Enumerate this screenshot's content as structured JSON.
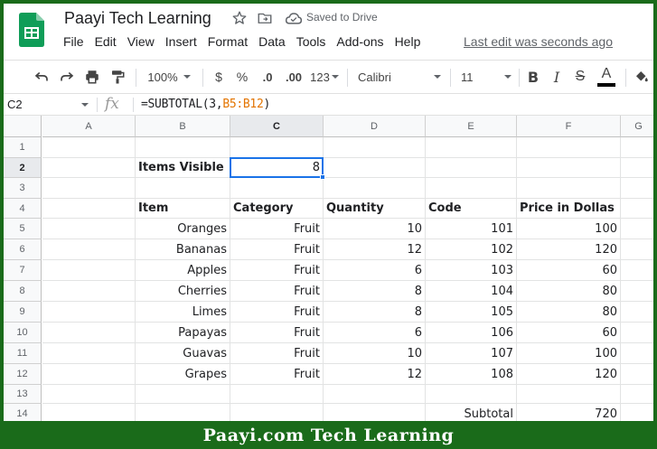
{
  "window": {
    "doc_title": "Paayi Tech Learning",
    "saved_status": "Saved to Drive",
    "last_edit": "Last edit was seconds ago"
  },
  "menu": [
    "File",
    "Edit",
    "View",
    "Insert",
    "Format",
    "Data",
    "Tools",
    "Add-ons",
    "Help"
  ],
  "toolbar": {
    "zoom": "100%",
    "currency": "$",
    "percent": "%",
    "decrease_decimal": ".0",
    "increase_decimal": ".00",
    "more_formats": "123",
    "font": "Calibri",
    "font_size": "11",
    "bold": "B",
    "italic": "I",
    "strike": "S",
    "text_color": "A"
  },
  "formula_bar": {
    "cell_ref": "C2",
    "fx": "fx",
    "formula_prefix": "=SUBTOTAL(3,",
    "formula_ref": "B5:B12",
    "formula_suffix": ")"
  },
  "columns": [
    "A",
    "B",
    "C",
    "D",
    "E",
    "F",
    "G"
  ],
  "rows": [
    "1",
    "2",
    "3",
    "4",
    "5",
    "6",
    "7",
    "8",
    "9",
    "10",
    "11",
    "12",
    "13",
    "14"
  ],
  "sheet": {
    "items_visible_label": "Items Visible",
    "items_visible_value": "8",
    "headers": [
      "Item",
      "Category",
      "Quantity",
      "Code",
      "Price in Dollas"
    ],
    "data": [
      [
        "Oranges",
        "Fruit",
        "10",
        "101",
        "100"
      ],
      [
        "Bananas",
        "Fruit",
        "12",
        "102",
        "120"
      ],
      [
        "Apples",
        "Fruit",
        "6",
        "103",
        "60"
      ],
      [
        "Cherries",
        "Fruit",
        "8",
        "104",
        "80"
      ],
      [
        "Limes",
        "Fruit",
        "8",
        "105",
        "80"
      ],
      [
        "Papayas",
        "Fruit",
        "6",
        "106",
        "60"
      ],
      [
        "Guavas",
        "Fruit",
        "10",
        "107",
        "100"
      ],
      [
        "Grapes",
        "Fruit",
        "12",
        "108",
        "120"
      ]
    ],
    "subtotal_label": "Subtotal",
    "subtotal_value": "720"
  },
  "footer_text": "Paayi.com Tech Learning",
  "colors": {
    "frame_green": "#1a6b1a",
    "sheets_green": "#0f9d58",
    "selection_blue": "#1a73e8",
    "formula_ref_orange": "#e37400"
  }
}
